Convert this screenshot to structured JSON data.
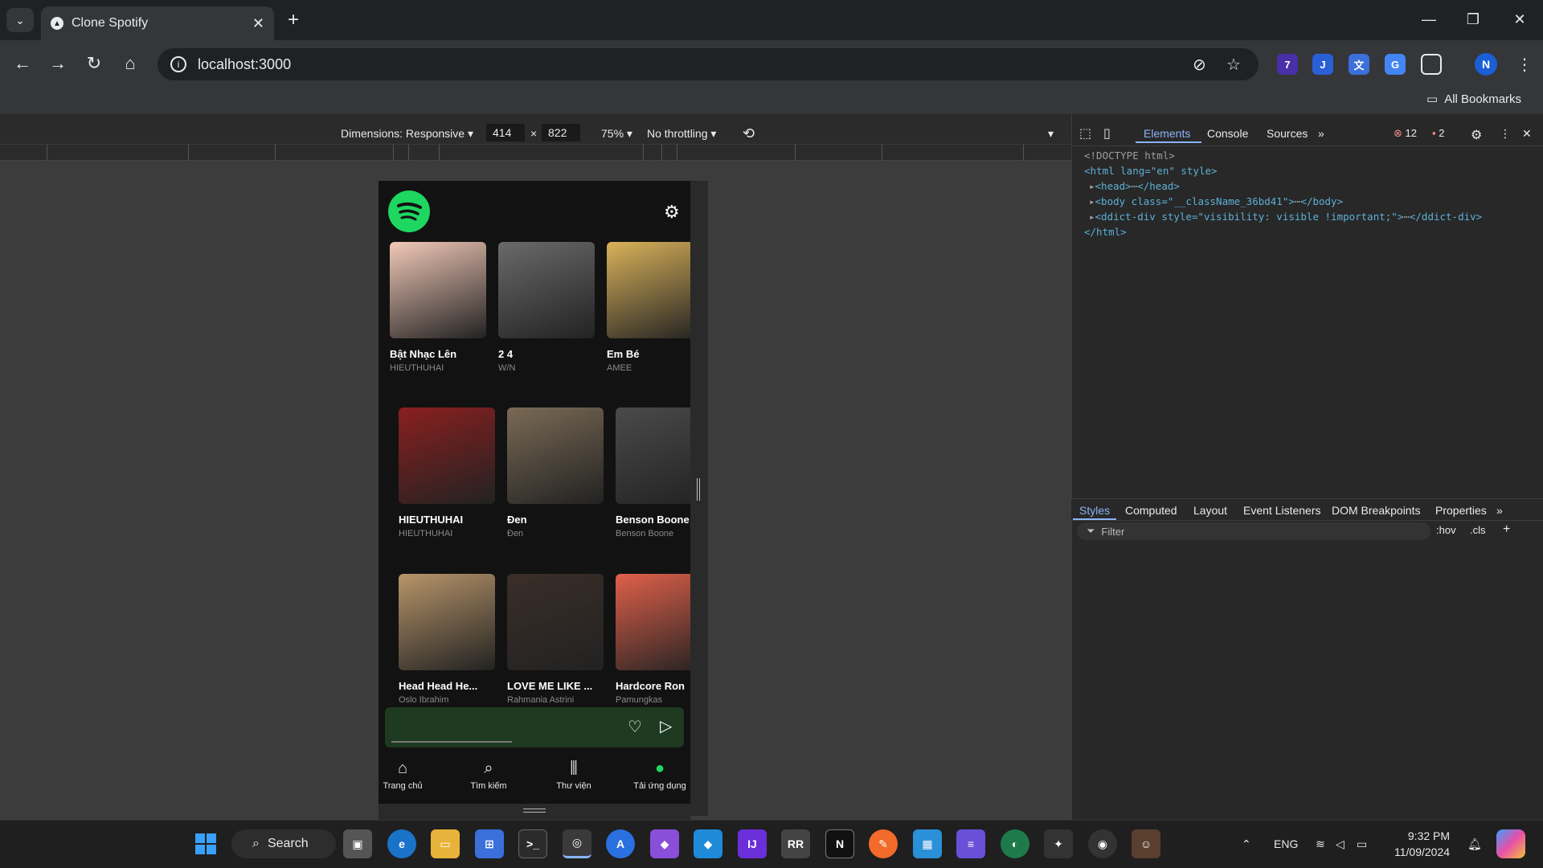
{
  "browser": {
    "tab_title": "Clone Spotify",
    "url": "localhost:3000",
    "bookmarks_label": "All Bookmarks",
    "ext_badge": "7",
    "profile_initial": "N"
  },
  "device_toolbar": {
    "dimensions_label": "Dimensions: Responsive",
    "width": "414",
    "height": "822",
    "zoom": "75%",
    "throttling": "No throttling",
    "times": "×"
  },
  "app": {
    "rows": [
      [
        {
          "title": "Bật Nhạc Lên",
          "artist": "HIEUTHUHAI",
          "color": "#f2c9b8"
        },
        {
          "title": "2 4",
          "artist": "W/N",
          "color": "#6a6a6a"
        },
        {
          "title": "Em Bé",
          "artist": "AMEE",
          "color": "#d9b25a"
        }
      ],
      [
        {
          "title": "HIEUTHUHAI",
          "artist": "HIEUTHUHAI",
          "color": "#8a1f1f"
        },
        {
          "title": "Đen",
          "artist": "Đen",
          "color": "#7a6a55"
        },
        {
          "title": "Benson Boone",
          "artist": "Benson Boone",
          "color": "#4a4a4a"
        }
      ],
      [
        {
          "title": "Head Head He...",
          "artist": "Oslo Ibrahim",
          "color": "#b8956a"
        },
        {
          "title": "LOVE ME LIKE ...",
          "artist": "Rahmania Astrini",
          "color": "#3a2e28"
        },
        {
          "title": "Hardcore Ron",
          "artist": "Pamungkas",
          "color": "#e0604a"
        }
      ]
    ],
    "nav": [
      {
        "label": "Trang chủ",
        "icon": "home-icon",
        "glyph": "⌂"
      },
      {
        "label": "Tìm kiếm",
        "icon": "search-icon",
        "glyph": "⌕"
      },
      {
        "label": "Thư viện",
        "icon": "library-icon",
        "glyph": "⫼"
      },
      {
        "label": "Tải ứng dụng",
        "icon": "spotify-icon",
        "glyph": "●"
      }
    ],
    "accent": "#1ed760"
  },
  "devtools": {
    "tabs": [
      "Elements",
      "Console",
      "Sources"
    ],
    "errors": "12",
    "warnings": "2",
    "dom": {
      "doctype": "<!DOCTYPE html>",
      "html_open": "<html lang=\"en\" style>",
      "head": "<head>",
      "head_close": "</head>",
      "body_open": "<body class=\"__className_36bd41\">",
      "body_close": "</body>",
      "ddict_open": "<ddict-div style=\"visibility: visible !important;\">",
      "ddict_close": "</ddict-div>",
      "html_close": "</html>",
      "ellipsis": "⋯"
    },
    "styles_tabs": [
      "Styles",
      "Computed",
      "Layout",
      "Event Listeners",
      "DOM Breakpoints",
      "Properties"
    ],
    "filter_placeholder": "Filter",
    "hov": ":hov",
    "cls": ".cls"
  },
  "taskbar": {
    "search_label": "Search",
    "lang": "ENG",
    "time": "9:32 PM",
    "date": "11/09/2024"
  }
}
